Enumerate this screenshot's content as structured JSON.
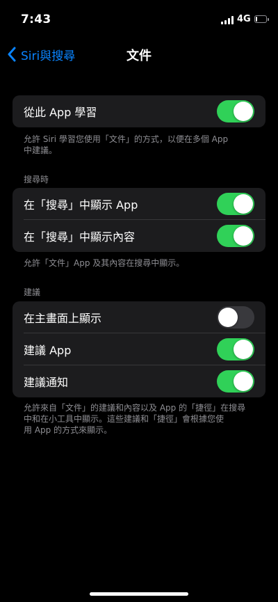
{
  "status_bar": {
    "time": "7:43",
    "network": "4G",
    "icons": [
      "signal-icon",
      "battery-icon"
    ]
  },
  "nav": {
    "back_label": "Siri與搜尋",
    "back_icon": "chevron-left-icon",
    "title": "文件"
  },
  "colors": {
    "accent": "#0a84ff",
    "toggle_on": "#30d158",
    "toggle_off": "#39393d",
    "group_bg": "#1c1c1e",
    "secondary_text": "#8e8e93"
  },
  "learn_section": {
    "row": {
      "label": "從此 App 學習",
      "on": true
    },
    "footer_lines": [
      "允許 Siri 學習您使用「文件」的方式，以便在多個 App",
      "中建議。"
    ]
  },
  "search_section": {
    "header": "搜尋時",
    "rows": [
      {
        "label": "在「搜尋」中顯示 App",
        "on": true
      },
      {
        "label": "在「搜尋」中顯示內容",
        "on": true
      }
    ],
    "footer": "允許「文件」App 及其內容在搜尋中顯示。"
  },
  "suggestions_section": {
    "header": "建議",
    "rows": [
      {
        "label": "在主畫面上顯示",
        "on": false
      },
      {
        "label": "建議 App",
        "on": true
      },
      {
        "label": "建議通知",
        "on": true
      }
    ],
    "footer_lines": [
      "允許來自「文件」的建議和內容以及 App 的「捷徑」在搜尋",
      "中和在小工具中顯示。這些建議和「捷徑」會根據您使",
      "用 App 的方式來顯示。"
    ]
  }
}
